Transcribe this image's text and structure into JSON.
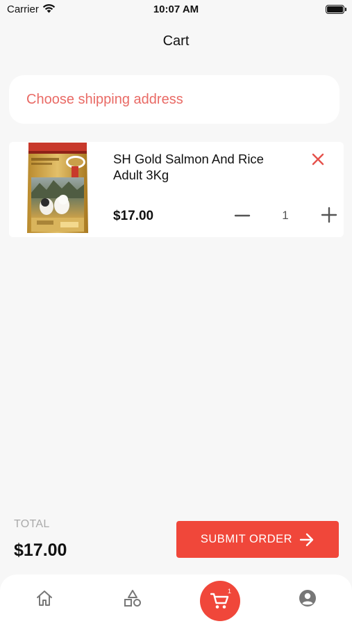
{
  "status_bar": {
    "carrier": "Carrier",
    "time": "10:07 AM",
    "icons": [
      "wifi-icon",
      "battery-icon"
    ]
  },
  "header": {
    "title": "Cart"
  },
  "shipping": {
    "prompt": "Choose shipping address"
  },
  "cart_items": [
    {
      "name": "SH Gold Salmon And Rice Adult 3Kg",
      "price": "$17.00",
      "quantity": "1",
      "image": "dog-food-bag-image"
    }
  ],
  "summary": {
    "total_label": "TOTAL",
    "total_value": "$17.00",
    "submit_label": "SUBMIT ORDER"
  },
  "bottom_nav": {
    "items": [
      {
        "name": "home",
        "icon": "home-icon"
      },
      {
        "name": "categories",
        "icon": "shapes-icon"
      },
      {
        "name": "cart",
        "icon": "cart-icon",
        "badge": "1",
        "active": true
      },
      {
        "name": "account",
        "icon": "account-icon"
      }
    ]
  },
  "colors": {
    "accent": "#f0473a",
    "address_text": "#e96a65",
    "background": "#f7f7f7",
    "card": "#ffffff"
  }
}
